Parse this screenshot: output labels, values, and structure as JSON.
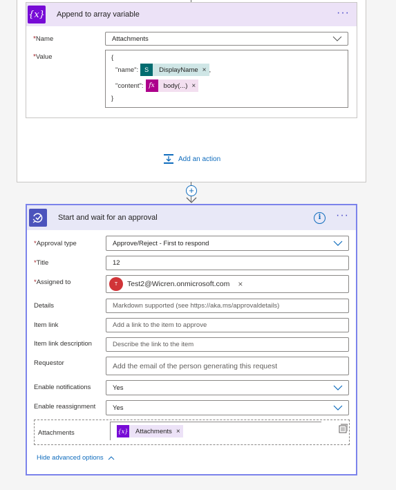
{
  "append_card": {
    "title": "Append to array variable",
    "icon": "variable-icon",
    "name_label": "Name",
    "name_value": "Attachments",
    "value_label": "Value",
    "value": {
      "open_brace": "{",
      "name_key": "\"name\":",
      "name_token": "DisplayName",
      "name_suffix": ",",
      "content_key": "\"content\":",
      "content_token": "body(...)",
      "close_brace": "}"
    },
    "add_action_label": "Add an action"
  },
  "approval_card": {
    "title": "Start and wait for an approval",
    "icon": "approval-icon",
    "fields": {
      "approval_type": {
        "label": "Approval type",
        "value": "Approve/Reject - First to respond"
      },
      "title": {
        "label": "Title",
        "value": "12"
      },
      "assigned_to": {
        "label": "Assigned to",
        "value": "Test2@Wicren.onmicrosoft.com",
        "initial": "T"
      },
      "details": {
        "label": "Details",
        "placeholder": "Markdown supported (see https://aka.ms/approvaldetails)"
      },
      "item_link": {
        "label": "Item link",
        "placeholder": "Add a link to the item to approve"
      },
      "item_link_description": {
        "label": "Item link description",
        "placeholder": "Describe the link to the item"
      },
      "requestor": {
        "label": "Requestor",
        "placeholder": "Add the email of the person generating this request"
      },
      "enable_notifications": {
        "label": "Enable notifications",
        "value": "Yes"
      },
      "enable_reassignment": {
        "label": "Enable reassignment",
        "value": "Yes"
      },
      "attachments": {
        "label": "Attachments",
        "token": "Attachments"
      }
    },
    "hide_advanced_label": "Hide advanced options"
  },
  "colors": {
    "accent": "#0f6cbd",
    "variable_purple": "#770bd6",
    "approval_blue": "#4b53bc",
    "sharepoint_teal": "#036c70",
    "expression_magenta": "#ad008c",
    "required_red": "#a4262c"
  }
}
